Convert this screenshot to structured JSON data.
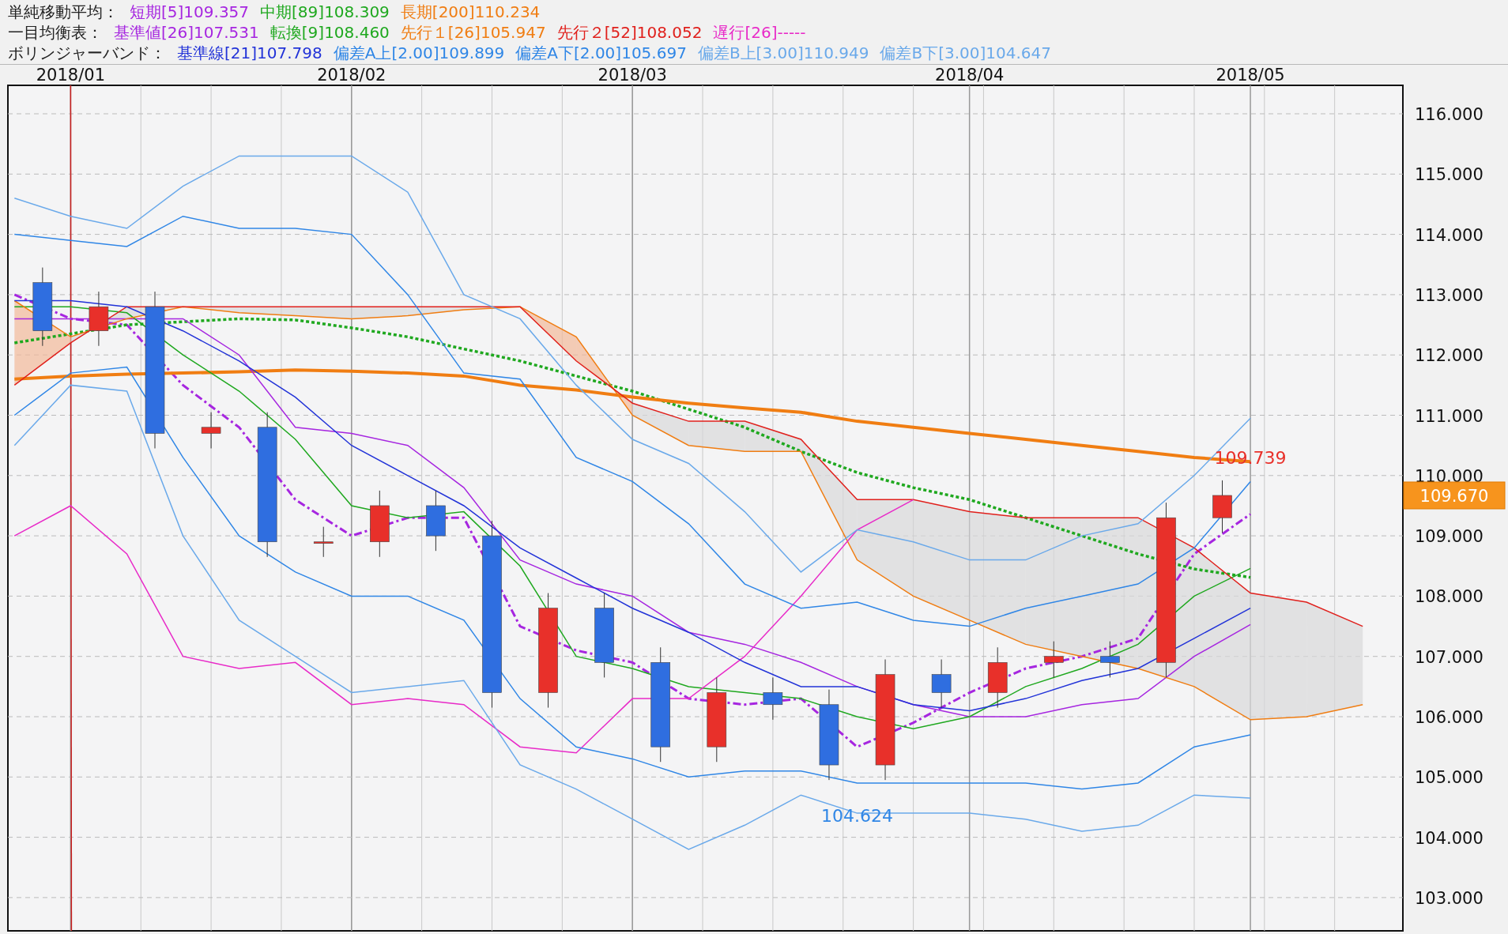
{
  "legend": [
    {
      "title": "単純移動平均：",
      "values": [
        "109.357",
        "108.309",
        "110.234"
      ]
    },
    {
      "title": "一目均衡表：",
      "values": [
        "107.531",
        "108.460",
        "105.947",
        "108.052",
        "-----"
      ]
    },
    {
      "title": "ボリンジャーバンド：",
      "values": [
        "107.798",
        "109.899",
        "105.697",
        "110.949",
        "104.647"
      ]
    }
  ],
  "chart": {
    "current_price": {
      "label": "109.670"
    },
    "chart_data": {
      "type": "line",
      "grid": true,
      "categories": [
        null,
        "2018/01",
        null,
        null,
        null,
        null,
        "2018/02",
        null,
        null,
        null,
        null,
        "2018/03",
        null,
        null,
        null,
        null,
        null,
        "2018/04",
        null,
        null,
        null,
        null,
        "2018/05",
        null,
        null
      ],
      "ylim": [
        103,
        116
      ],
      "yticks": [
        {
          "value": 116,
          "label": "116.000"
        },
        {
          "value": 115,
          "label": "115.000"
        },
        {
          "value": 114,
          "label": "114.000"
        },
        {
          "value": 113,
          "label": "113.000"
        },
        {
          "value": 112,
          "label": "112.000"
        },
        {
          "value": 111,
          "label": "111.000"
        },
        {
          "value": 110,
          "label": "110.000"
        },
        {
          "value": 109,
          "label": "109.000"
        },
        {
          "value": 108,
          "label": "108.000"
        },
        {
          "value": 107,
          "label": "107.000"
        },
        {
          "value": 106,
          "label": "106.000"
        },
        {
          "value": 105,
          "label": "105.000"
        },
        {
          "value": 104,
          "label": "104.000"
        },
        {
          "value": 103,
          "label": "103.000"
        }
      ],
      "series": [
        {
          "name": "短期[5]",
          "color": "#a626e0",
          "line_style": "dashdot",
          "values": [
            113.0,
            112.6,
            112.5,
            111.5,
            110.8,
            109.6,
            109.0,
            109.3,
            109.3,
            107.5,
            107.1,
            106.9,
            106.3,
            106.2,
            106.3,
            105.5,
            105.9,
            106.4,
            106.8,
            107.0,
            107.3,
            108.7,
            109.36,
            null,
            null
          ]
        },
        {
          "name": "中期[89]",
          "color": "#1fa81f",
          "line_style": "dotted",
          "values": [
            112.2,
            112.35,
            112.5,
            112.55,
            112.6,
            112.58,
            112.45,
            112.3,
            112.1,
            111.9,
            111.65,
            111.4,
            111.1,
            110.8,
            110.4,
            110.05,
            109.8,
            109.6,
            109.3,
            109.0,
            108.7,
            108.45,
            108.31,
            null,
            null
          ]
        },
        {
          "name": "長期[200]",
          "color": "#f07d12",
          "values": [
            111.6,
            111.65,
            111.68,
            111.7,
            111.72,
            111.75,
            111.73,
            111.7,
            111.65,
            111.5,
            111.42,
            111.3,
            111.2,
            111.12,
            111.05,
            110.9,
            110.8,
            110.7,
            110.6,
            110.5,
            110.4,
            110.3,
            110.23,
            null,
            null
          ]
        },
        {
          "name": "基準値[26]",
          "color": "#a626e0",
          "values": [
            112.6,
            112.6,
            112.6,
            112.6,
            112.0,
            110.8,
            110.7,
            110.5,
            109.8,
            108.6,
            108.2,
            108.0,
            107.4,
            107.2,
            106.9,
            106.5,
            106.2,
            106.0,
            106.0,
            106.2,
            106.3,
            107.0,
            107.53,
            null,
            null
          ]
        },
        {
          "name": "転換[9]",
          "color": "#1fa81f",
          "values": [
            112.8,
            112.8,
            112.7,
            112.0,
            111.4,
            110.6,
            109.5,
            109.3,
            109.4,
            108.5,
            107.0,
            106.8,
            106.5,
            106.4,
            106.3,
            106.0,
            105.8,
            106.0,
            106.5,
            106.8,
            107.2,
            108.0,
            108.46,
            null,
            null
          ]
        },
        {
          "name": "先行１[26]",
          "color": "#f07d12",
          "values": [
            112.9,
            112.3,
            112.6,
            112.8,
            112.7,
            112.65,
            112.6,
            112.65,
            112.75,
            112.8,
            112.3,
            111.0,
            110.5,
            110.4,
            110.4,
            108.6,
            108.0,
            107.6,
            107.2,
            107.0,
            106.8,
            106.5,
            105.95,
            106.0,
            106.2
          ]
        },
        {
          "name": "先行２[52]",
          "color": "#e0201c",
          "values": [
            111.5,
            112.2,
            112.8,
            112.8,
            112.8,
            112.8,
            112.8,
            112.8,
            112.8,
            112.8,
            111.9,
            111.2,
            110.9,
            110.9,
            110.6,
            109.6,
            109.6,
            109.4,
            109.3,
            109.3,
            109.3,
            108.8,
            108.05,
            107.9,
            107.5
          ]
        },
        {
          "name": "遅行[26]",
          "color": "#e82ac8",
          "values": [
            109.0,
            109.5,
            108.7,
            107.0,
            106.8,
            106.9,
            106.2,
            106.3,
            106.2,
            105.5,
            105.4,
            106.3,
            106.3,
            107.0,
            108.0,
            109.1,
            109.6,
            null,
            null,
            null,
            null,
            null,
            null,
            null,
            null
          ]
        },
        {
          "name": "基準線[21]",
          "color": "#2233d8",
          "values": [
            112.9,
            112.9,
            112.8,
            112.4,
            111.9,
            111.3,
            110.5,
            110.0,
            109.5,
            108.8,
            108.3,
            107.8,
            107.4,
            106.9,
            106.5,
            106.5,
            106.2,
            106.1,
            106.3,
            106.6,
            106.8,
            107.3,
            107.8,
            null,
            null
          ]
        },
        {
          "name": "偏差A上[2.00]",
          "color": "#2f86e6",
          "values": [
            114.0,
            113.9,
            113.8,
            114.3,
            114.1,
            114.1,
            114.0,
            113.0,
            111.7,
            111.6,
            110.3,
            109.9,
            109.2,
            108.2,
            107.8,
            107.9,
            107.6,
            107.5,
            107.8,
            108.0,
            108.2,
            108.8,
            109.9,
            null,
            null
          ]
        },
        {
          "name": "偏差A下[2.00]",
          "color": "#2f86e6",
          "values": [
            111.0,
            111.7,
            111.8,
            110.3,
            109.0,
            108.4,
            108.0,
            108.0,
            107.6,
            106.3,
            105.5,
            105.3,
            105.0,
            105.1,
            105.1,
            104.9,
            104.9,
            104.9,
            104.9,
            104.8,
            104.9,
            105.5,
            105.7,
            null,
            null
          ]
        },
        {
          "name": "偏差B上[3.00]",
          "color": "#6aa9ea",
          "values": [
            114.6,
            114.3,
            114.1,
            114.8,
            115.3,
            115.3,
            115.3,
            114.7,
            113.0,
            112.6,
            111.5,
            110.6,
            110.2,
            109.4,
            108.4,
            109.1,
            108.9,
            108.6,
            108.6,
            109.0,
            109.2,
            110.0,
            110.95,
            null,
            null
          ]
        },
        {
          "name": "偏差B下[3.00]",
          "color": "#6aa9ea",
          "values": [
            110.5,
            111.5,
            111.4,
            109.0,
            107.6,
            107.0,
            106.4,
            106.5,
            106.6,
            105.2,
            104.8,
            104.3,
            103.8,
            104.2,
            104.7,
            104.4,
            104.4,
            104.4,
            104.3,
            104.1,
            104.2,
            104.7,
            104.65,
            null,
            null
          ]
        }
      ],
      "annotations": [
        "109.739",
        "104.624"
      ]
    }
  }
}
